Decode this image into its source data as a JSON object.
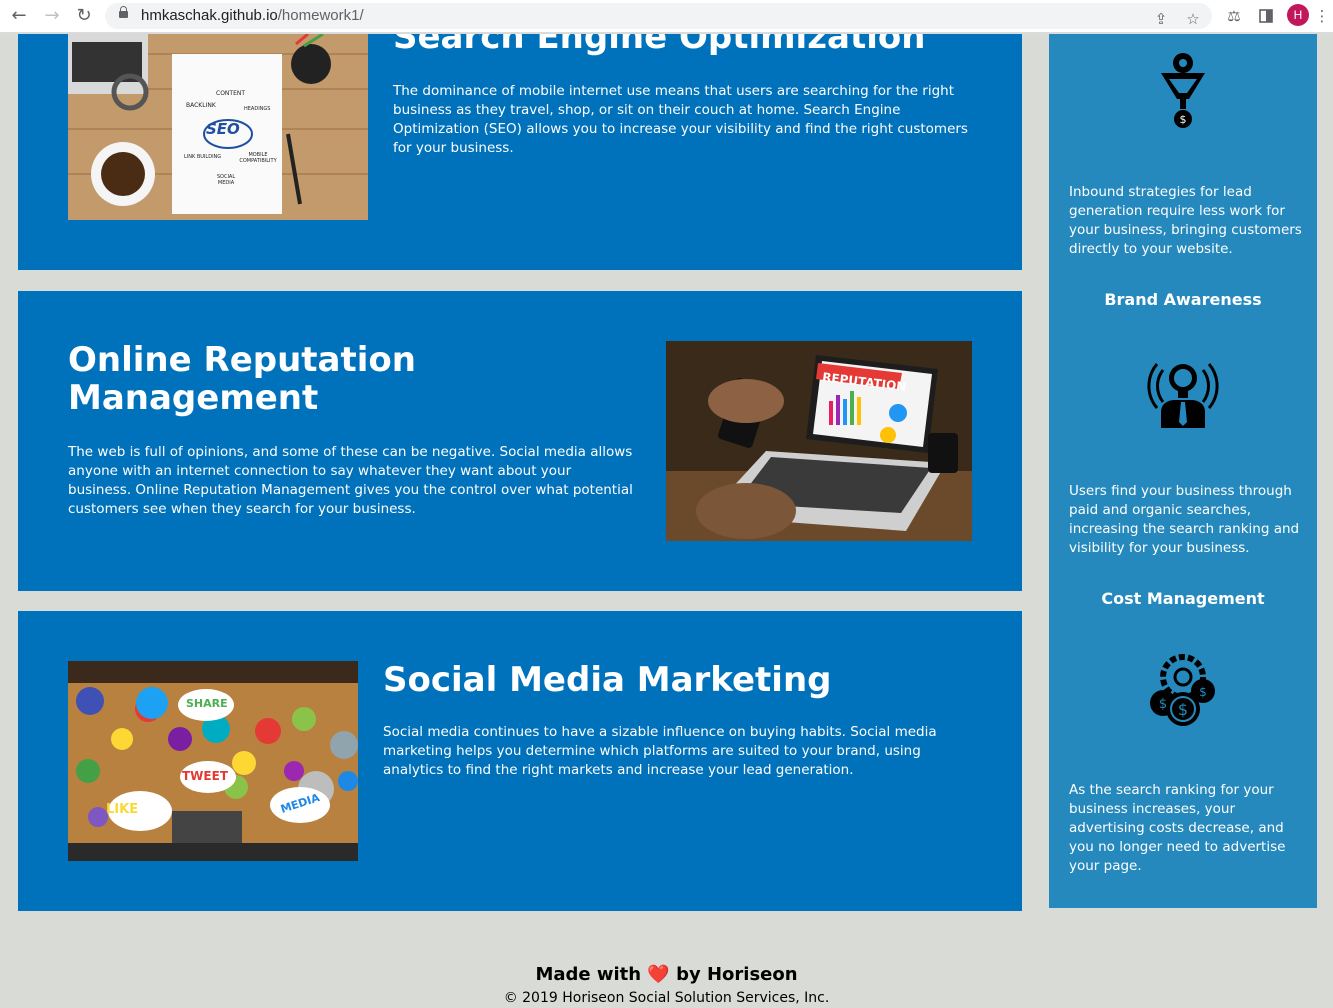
{
  "browser": {
    "url_host": "hmkaschak.github.io",
    "url_path": "/homework1/",
    "profile_initial": "H"
  },
  "cards": [
    {
      "title": "Search Engine Optimization",
      "text": "The dominance of mobile internet use means that users are searching for the right business as they travel, shop, or sit on their couch at home. Search Engine Optimization (SEO) allows you to increase your visibility and find the right customers for your business.",
      "image_labels": {
        "center": "SEO",
        "content": "CONTENT",
        "backlink": "BACKLINK",
        "headings": "HEADINGS",
        "link_building": "LINK BUILDING",
        "mobile": "MOBILE COMPATIBILITY",
        "social": "SOCIAL MEDIA"
      }
    },
    {
      "title": "Online Reputation Management",
      "text": "The web is full of opinions, and some of these can be negative. Social media allows anyone with an internet connection to say whatever they want about your business. Online Reputation Management gives you the control over what potential customers see when they search for your business.",
      "image_labels": {
        "screen": "REPUTATION"
      }
    },
    {
      "title": "Social Media Marketing",
      "text": "Social media continues to have a sizable influence on buying habits. Social media marketing helps you determine which platforms are suited to your brand, using analytics to find the right markets and increase your lead generation.",
      "image_labels": {
        "share": "SHARE",
        "tweet": "TWEET",
        "like": "LIKE",
        "media": "MEDIA"
      }
    }
  ],
  "benefits": [
    {
      "text": "Inbound strategies for lead generation require less work for your business, bringing customers directly to your website.",
      "icon": "lead-funnel-icon"
    },
    {
      "title": "Brand Awareness",
      "text": "Users find your business through paid and organic searches, increasing the search ranking and visibility for your business.",
      "icon": "brand-awareness-icon"
    },
    {
      "title": "Cost Management",
      "text": "As the search ranking for your business increases, your advertising costs decrease, and you no longer need to advertise your page.",
      "icon": "cost-management-icon"
    }
  ],
  "footer": {
    "made_with": "Made with",
    "heart": "❤️",
    "by": "by Horiseon",
    "copyright": "© 2019 Horiseon Social Solution Services, Inc."
  },
  "colors": {
    "card_bg": "#0072bb",
    "aside_bg": "#2589bd",
    "page_bg": "#d9dcd6"
  }
}
